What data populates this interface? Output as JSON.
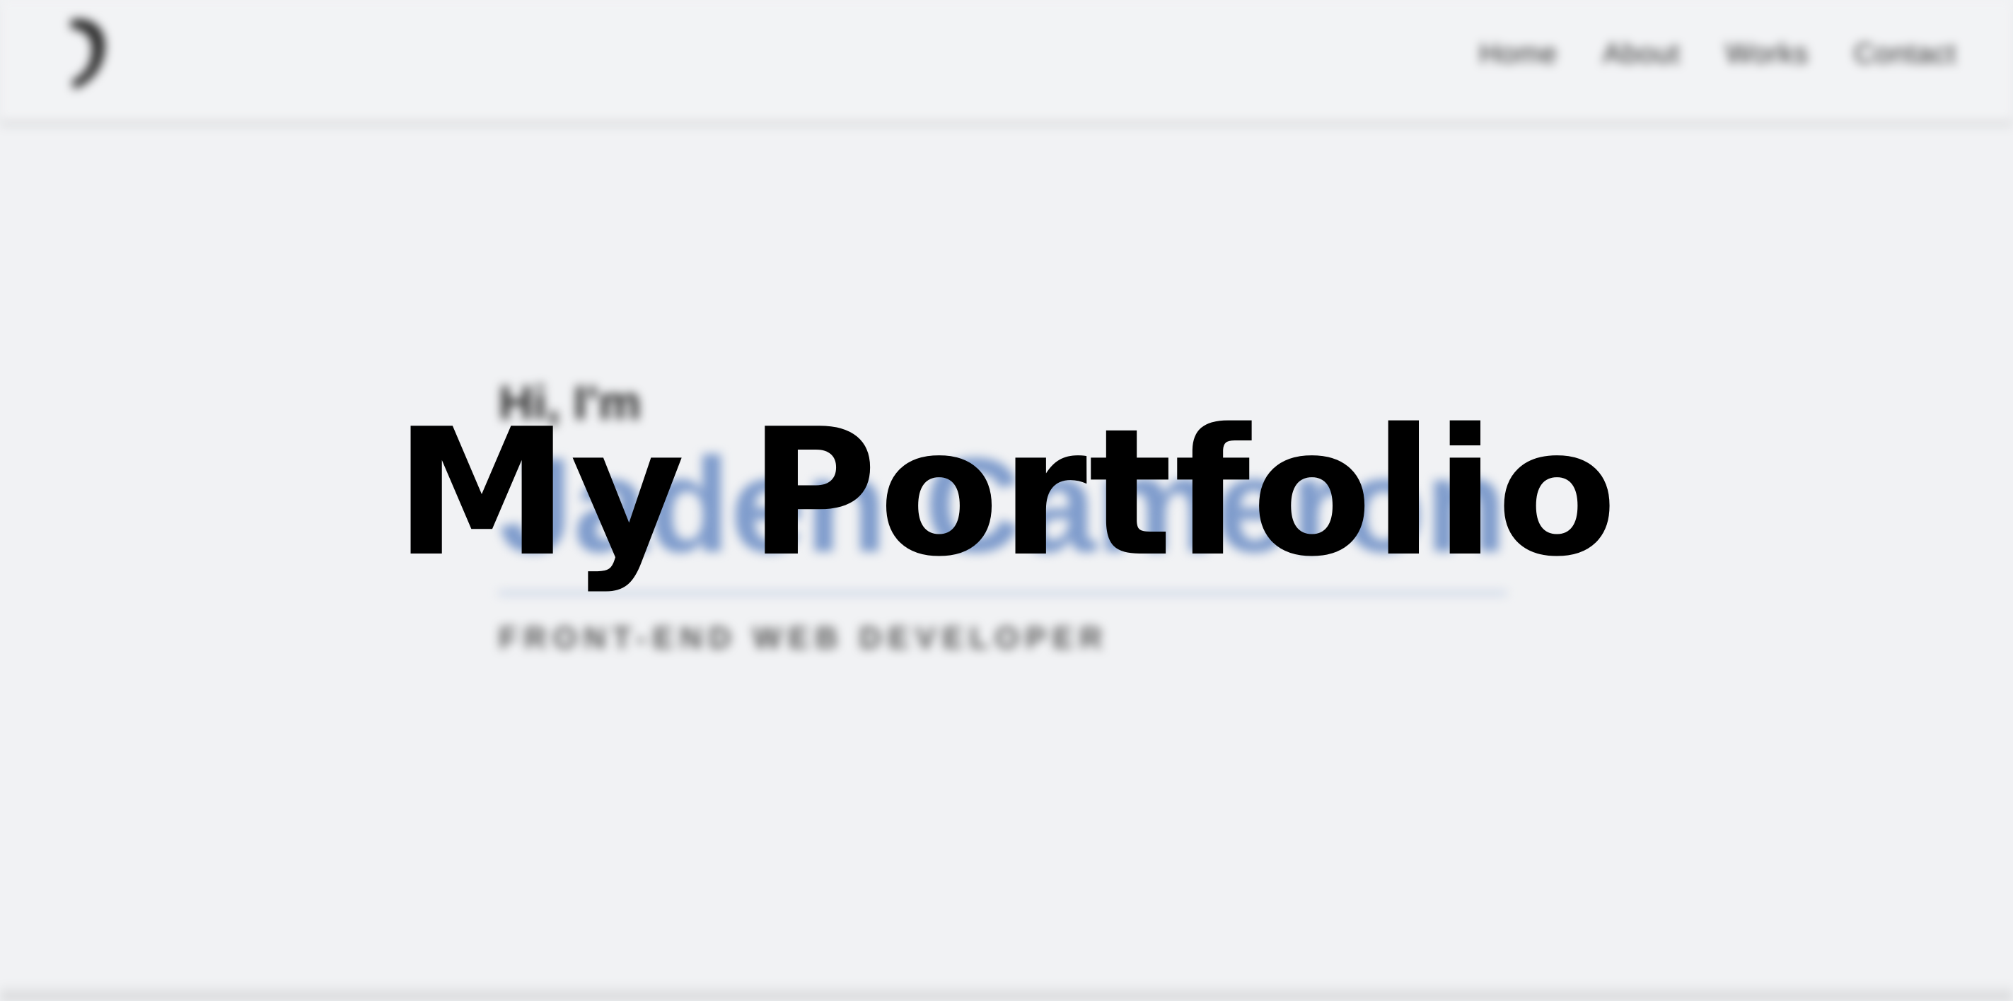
{
  "nav": {
    "logo_icon": "j-logo-icon",
    "links": [
      "Home",
      "About",
      "Works",
      "Contact"
    ]
  },
  "hero": {
    "greeting": "Hi, I'm",
    "name": "Jaden Cameron",
    "role": "FRONT-END WEB DEVELOPER"
  },
  "overlay": {
    "title": "My Portfolio"
  },
  "colors": {
    "background": "#f1f2f4",
    "name_accent": "#7f9ccc",
    "divider": "#c6d2e6",
    "overlay_text": "#000000"
  }
}
